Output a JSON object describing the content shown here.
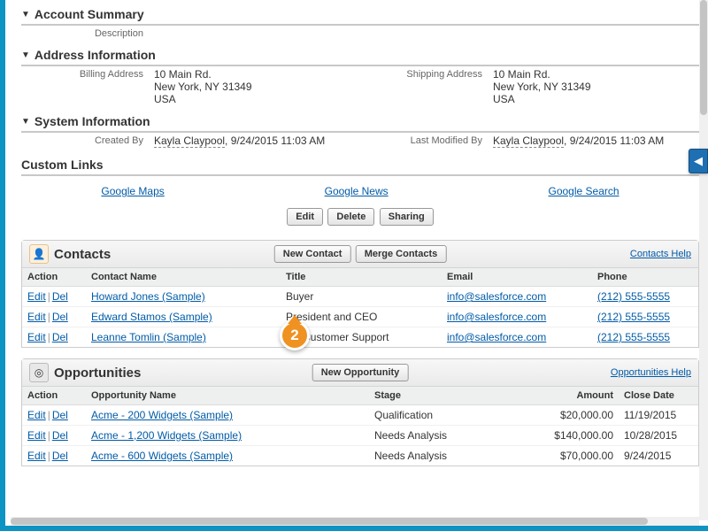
{
  "sections": {
    "account_summary": {
      "title": "Account Summary",
      "description_label": "Description",
      "description_value": ""
    },
    "address_info": {
      "title": "Address Information",
      "billing_label": "Billing Address",
      "billing_value_line1": "10 Main Rd.",
      "billing_value_line2": "New York, NY 31349",
      "billing_value_line3": "USA",
      "shipping_label": "Shipping Address",
      "shipping_value_line1": "10 Main Rd.",
      "shipping_value_line2": "New York, NY 31349",
      "shipping_value_line3": "USA"
    },
    "system_info": {
      "title": "System Information",
      "created_by_label": "Created By",
      "created_by_name": "Kayla Claypool",
      "created_by_suffix": ", 9/24/2015 11:03 AM",
      "modified_by_label": "Last Modified By",
      "modified_by_name": "Kayla Claypool",
      "modified_by_suffix": ", 9/24/2015 11:03 AM"
    }
  },
  "custom_links": {
    "title": "Custom Links",
    "links": [
      "Google Maps",
      "Google News",
      "Google Search"
    ]
  },
  "action_buttons": {
    "edit": "Edit",
    "delete": "Delete",
    "sharing": "Sharing"
  },
  "contacts": {
    "title": "Contacts",
    "new_btn": "New Contact",
    "merge_btn": "Merge Contacts",
    "help": "Contacts Help",
    "headers": {
      "action": "Action",
      "name": "Contact Name",
      "title": "Title",
      "email": "Email",
      "phone": "Phone"
    },
    "row_actions": {
      "edit": "Edit",
      "del": "Del"
    },
    "rows": [
      {
        "name": "Howard Jones (Sample)",
        "title": "Buyer",
        "email": "info@salesforce.com",
        "phone": "(212) 555-5555"
      },
      {
        "name": "Edward Stamos (Sample)",
        "title": "President and CEO",
        "email": "info@salesforce.com",
        "phone": "(212) 555-5555"
      },
      {
        "name": "Leanne Tomlin (Sample)",
        "title": "VP Customer Support",
        "email": "info@salesforce.com",
        "phone": "(212) 555-5555"
      }
    ]
  },
  "opportunities": {
    "title": "Opportunities",
    "new_btn": "New Opportunity",
    "help": "Opportunities Help",
    "headers": {
      "action": "Action",
      "name": "Opportunity Name",
      "stage": "Stage",
      "amount": "Amount",
      "close": "Close Date"
    },
    "row_actions": {
      "edit": "Edit",
      "del": "Del"
    },
    "rows": [
      {
        "name": "Acme - 200 Widgets (Sample)",
        "stage": "Qualification",
        "amount": "$20,000.00",
        "close": "11/19/2015"
      },
      {
        "name": "Acme - 1,200 Widgets (Sample)",
        "stage": "Needs Analysis",
        "amount": "$140,000.00",
        "close": "10/28/2015"
      },
      {
        "name": "Acme - 600 Widgets (Sample)",
        "stage": "Needs Analysis",
        "amount": "$70,000.00",
        "close": "9/24/2015"
      }
    ]
  },
  "callout_number": "2"
}
